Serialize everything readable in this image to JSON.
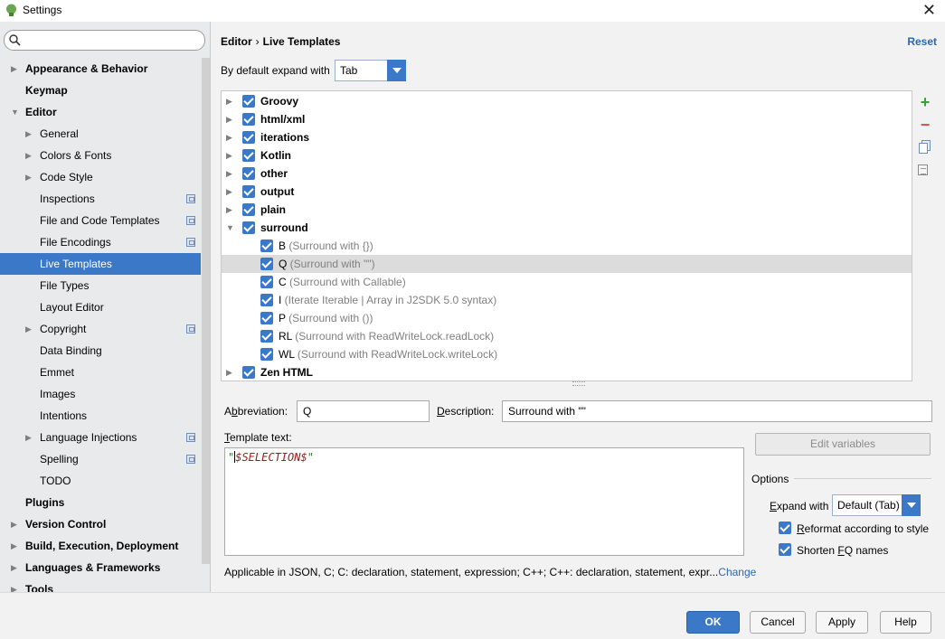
{
  "window": {
    "title": "Settings",
    "close": "✕"
  },
  "search": {
    "placeholder": ""
  },
  "sidebar": {
    "items": [
      {
        "label": "Appearance & Behavior",
        "arrow": "▶"
      },
      {
        "label": "Keymap"
      },
      {
        "label": "Editor",
        "arrow": "▼"
      },
      {
        "label": "General",
        "arrow": "▶"
      },
      {
        "label": "Colors & Fonts",
        "arrow": "▶"
      },
      {
        "label": "Code Style",
        "arrow": "▶"
      },
      {
        "label": "Inspections"
      },
      {
        "label": "File and Code Templates"
      },
      {
        "label": "File Encodings"
      },
      {
        "label": "Live Templates"
      },
      {
        "label": "File Types"
      },
      {
        "label": "Layout Editor"
      },
      {
        "label": "Copyright",
        "arrow": "▶"
      },
      {
        "label": "Data Binding"
      },
      {
        "label": "Emmet"
      },
      {
        "label": "Images"
      },
      {
        "label": "Intentions"
      },
      {
        "label": "Language Injections",
        "arrow": "▶"
      },
      {
        "label": "Spelling"
      },
      {
        "label": "TODO"
      },
      {
        "label": "Plugins"
      },
      {
        "label": "Version Control",
        "arrow": "▶"
      },
      {
        "label": "Build, Execution, Deployment",
        "arrow": "▶"
      },
      {
        "label": "Languages & Frameworks",
        "arrow": "▶"
      },
      {
        "label": "Tools",
        "arrow": "▶"
      }
    ]
  },
  "header": {
    "crumb1": "Editor",
    "sep": "›",
    "crumb2": "Live Templates",
    "reset": "Reset",
    "expand_label": "By default expand with",
    "expand_value": "Tab"
  },
  "templates": {
    "groups": [
      {
        "arrow": "▶",
        "name": "Groovy"
      },
      {
        "arrow": "▶",
        "name": "html/xml"
      },
      {
        "arrow": "▶",
        "name": "iterations"
      },
      {
        "arrow": "▶",
        "name": "Kotlin"
      },
      {
        "arrow": "▶",
        "name": "other"
      },
      {
        "arrow": "▶",
        "name": "output"
      },
      {
        "arrow": "▶",
        "name": "plain"
      },
      {
        "arrow": "▼",
        "name": "surround"
      }
    ],
    "items": [
      {
        "abbr": "B",
        "desc": " (Surround with {})"
      },
      {
        "abbr": "Q",
        "desc": " (Surround with \"\")"
      },
      {
        "abbr": "C",
        "desc": " (Surround with Callable)"
      },
      {
        "abbr": "I",
        "desc": " (Iterate Iterable | Array in J2SDK 5.0 syntax)"
      },
      {
        "abbr": "P",
        "desc": " (Surround with ())"
      },
      {
        "abbr": "RL",
        "desc": " (Surround with ReadWriteLock.readLock)"
      },
      {
        "abbr": "WL",
        "desc": " (Surround with ReadWriteLock.writeLock)"
      }
    ],
    "last_group": {
      "arrow": "▶",
      "name": "Zen HTML"
    },
    "toolbar": {
      "add": "+",
      "remove": "−"
    }
  },
  "editor": {
    "abbr_label_pre": "A",
    "abbr_label_u": "b",
    "abbr_label_post": "breviation:",
    "abbr_value": "Q",
    "desc_label_pre": "",
    "desc_label_u": "D",
    "desc_label_post": "escription:",
    "desc_value": "Surround with \"\"",
    "template_label_pre": "",
    "template_label_u": "T",
    "template_label_post": "emplate text:",
    "template_quote_open": "\"",
    "template_var": "$SELECTION$",
    "template_quote_close": "\"",
    "edit_variables": "Edit variables",
    "options_title": "Options",
    "expand_with_pre": "",
    "expand_with_u": "E",
    "expand_with_post": "xpand with",
    "expand_with_value": "Default (Tab)",
    "reformat_pre": "",
    "reformat_u": "R",
    "reformat_post": "eformat according to style",
    "shorten_pre": "Shorten ",
    "shorten_u": "F",
    "shorten_post": "Q names",
    "applicable": "Applicable in JSON, C; C: declaration, statement, expression; C++; C++: declaration, statement, expr...",
    "change": "Change"
  },
  "buttons": {
    "ok": "OK",
    "cancel": "Cancel",
    "apply": "Apply",
    "help": "Help"
  },
  "colors": {
    "accent": "#3b78c8",
    "link": "#2f65ad",
    "selection": "#dcdcdc"
  }
}
